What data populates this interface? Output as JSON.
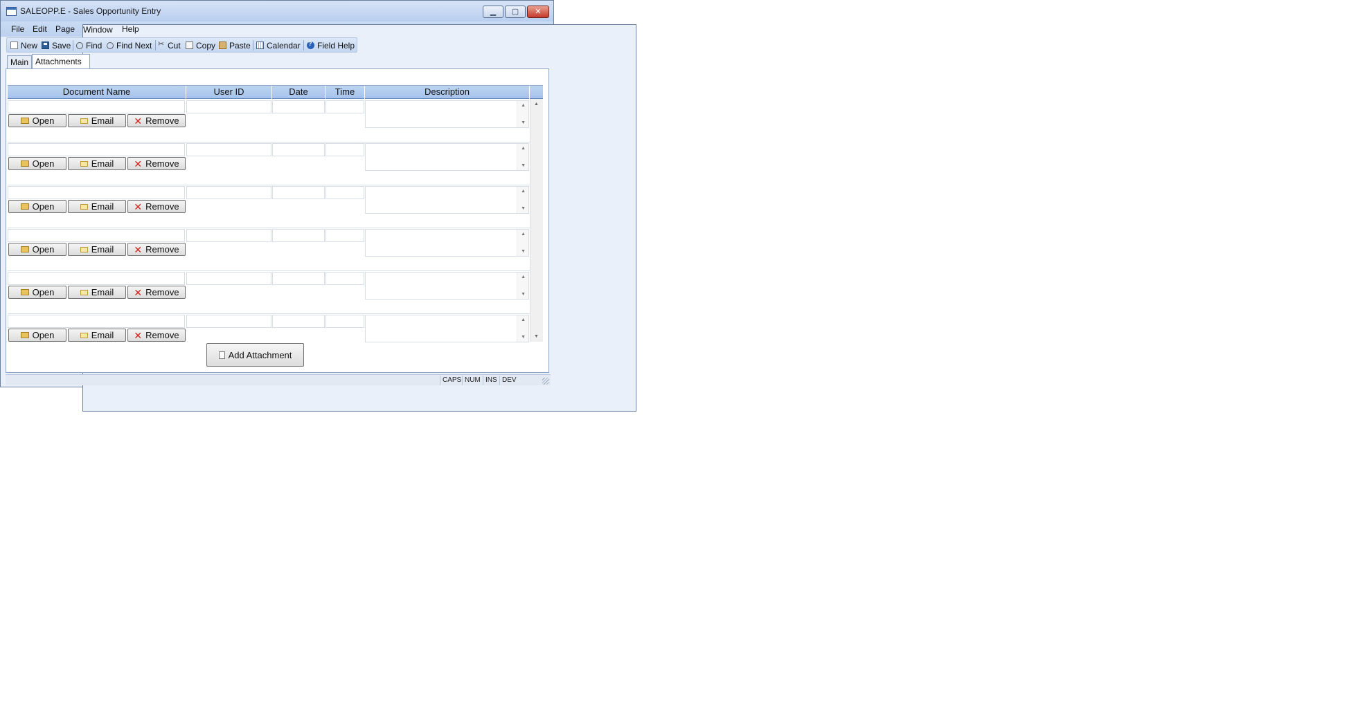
{
  "window": {
    "title": "SALEOPP.E - Sales Opportunity Entry",
    "controls": {
      "minimize": "▁",
      "maximize": "▢",
      "close": "✕"
    }
  },
  "menu": {
    "items": [
      {
        "label": "File"
      },
      {
        "label": "Edit"
      },
      {
        "label": "Page"
      },
      {
        "label": "Window"
      },
      {
        "label": "Help"
      }
    ]
  },
  "toolbar": {
    "new": "New",
    "save": "Save",
    "find": "Find",
    "find_next": "Find Next",
    "cut": "Cut",
    "copy": "Copy",
    "paste": "Paste",
    "calendar": "Calendar",
    "field_help": "Field Help"
  },
  "tabs": {
    "main": "Main",
    "attachments": "Attachments",
    "active": "Attachments"
  },
  "grid": {
    "columns": {
      "document_name": "Document Name",
      "user_id": "User ID",
      "date": "Date",
      "time": "Time",
      "description": "Description"
    },
    "row_buttons": {
      "open": "Open",
      "email": "Email",
      "remove": "Remove"
    },
    "rows": [
      {
        "document_name": "",
        "user_id": "",
        "date": "",
        "time": "",
        "description": ""
      },
      {
        "document_name": "",
        "user_id": "",
        "date": "",
        "time": "",
        "description": ""
      },
      {
        "document_name": "",
        "user_id": "",
        "date": "",
        "time": "",
        "description": ""
      },
      {
        "document_name": "",
        "user_id": "",
        "date": "",
        "time": "",
        "description": ""
      },
      {
        "document_name": "",
        "user_id": "",
        "date": "",
        "time": "",
        "description": ""
      },
      {
        "document_name": "",
        "user_id": "",
        "date": "",
        "time": "",
        "description": ""
      }
    ]
  },
  "actions": {
    "add_attachment": "Add Attachment"
  },
  "status": {
    "caps": "CAPS",
    "num": "NUM",
    "ins": "INS",
    "dev": "DEV"
  },
  "icons": {
    "app": "calendar-app-icon",
    "open": "folder-icon",
    "email": "envelope-icon",
    "remove": "red-x-icon",
    "add_attachment": "document-icon"
  }
}
